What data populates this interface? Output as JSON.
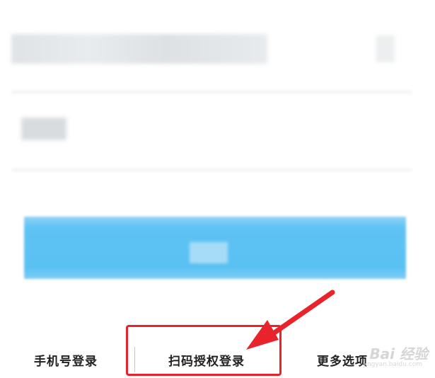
{
  "form": {
    "login_button_label": ""
  },
  "bottom_links": {
    "phone_login": "手机号登录",
    "scan_login": "扫码授权登录",
    "more_options": "更多选项"
  },
  "annotation": {
    "highlight_color": "#e8232b"
  },
  "watermark": {
    "text": "Bai 经验",
    "sub": "jingyan.baidu.com"
  },
  "colors": {
    "button": "#5ec3f3",
    "background": "#ffffff"
  }
}
